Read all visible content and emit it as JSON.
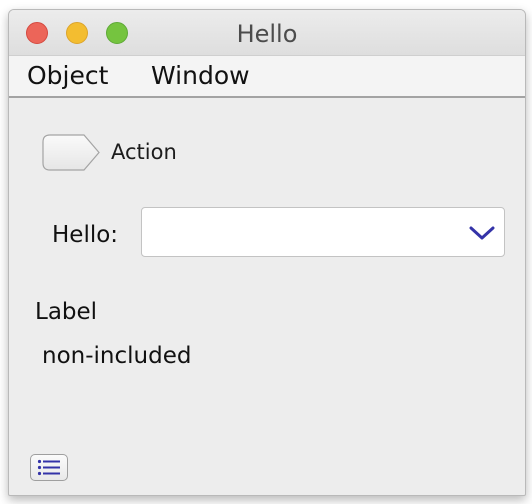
{
  "window": {
    "title": "Hello"
  },
  "menubar": {
    "items": [
      {
        "label": "Object"
      },
      {
        "label": "Window"
      }
    ]
  },
  "action": {
    "label": "Action"
  },
  "hello_field": {
    "label": "Hello:",
    "value": ""
  },
  "labels": {
    "label": "Label",
    "non_included": "non-included"
  },
  "icons": {
    "close": "close-traffic-light-icon",
    "minimize": "minimize-traffic-light-icon",
    "zoom": "zoom-traffic-light-icon",
    "dropdown": "chevron-down-icon",
    "list": "list-icon"
  },
  "colors": {
    "accent": "#3433a8",
    "close": "#ec6559",
    "minimize": "#f3bd30",
    "zoom": "#75c43f"
  }
}
